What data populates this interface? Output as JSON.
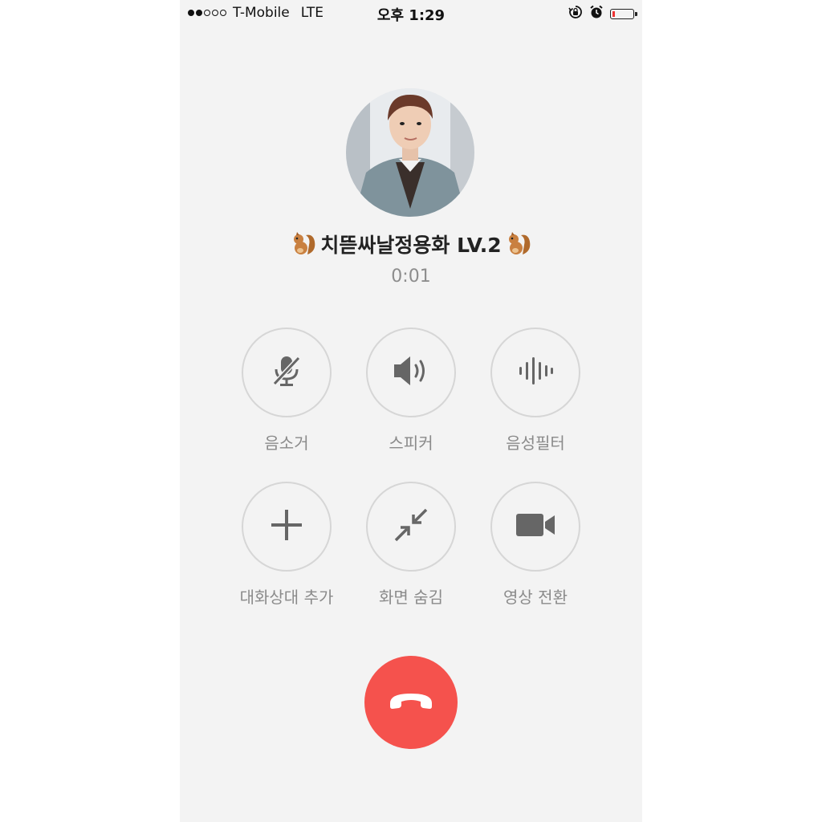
{
  "status_bar": {
    "signal_dots_filled": 2,
    "signal_dots_total": 5,
    "carrier": "T-Mobile",
    "network": "LTE",
    "time": "오후 1:29",
    "battery_level": 0.15,
    "icons": [
      "orientation-lock-icon",
      "alarm-icon",
      "battery-icon"
    ]
  },
  "call": {
    "caller_name": "치뜯싸날정용화 LV.2",
    "name_decoration_icon": "squirrel-emoji",
    "duration": "0:01"
  },
  "controls": [
    {
      "id": "mute",
      "icon": "mic-off-icon",
      "label": "음소거"
    },
    {
      "id": "speaker",
      "icon": "speaker-icon",
      "label": "스피커"
    },
    {
      "id": "voice-filter",
      "icon": "voice-wave-icon",
      "label": "음성필터"
    },
    {
      "id": "add-participant",
      "icon": "plus-icon",
      "label": "대화상대 추가"
    },
    {
      "id": "minimize",
      "icon": "minimize-arrows-icon",
      "label": "화면 숨김"
    },
    {
      "id": "video-switch",
      "icon": "video-camera-icon",
      "label": "영상 전환"
    }
  ],
  "end_call": {
    "icon": "hang-up-icon",
    "color": "#f5524d"
  },
  "colors": {
    "background": "#f3f3f3",
    "icon_gray": "#666666",
    "label_gray": "#8a8a8a",
    "end_call_red": "#f5524d"
  }
}
